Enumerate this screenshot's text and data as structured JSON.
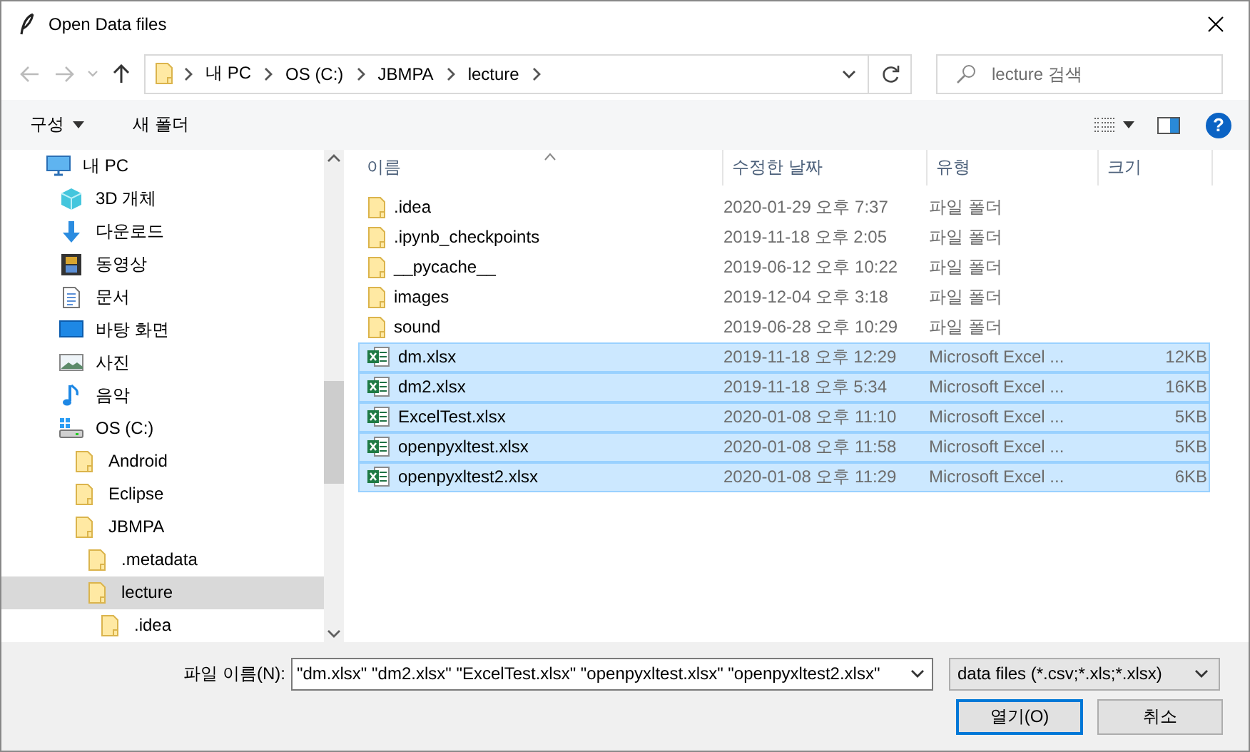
{
  "window": {
    "title": "Open Data files"
  },
  "address": {
    "crumbs": [
      "내 PC",
      "OS (C:)",
      "JBMPA",
      "lecture"
    ]
  },
  "search": {
    "placeholder": "lecture 검색"
  },
  "toolbar": {
    "organize": "구성",
    "new_folder": "새 폴더",
    "help": "?"
  },
  "tree": [
    {
      "label": "내 PC",
      "kind": "pc",
      "selected": false,
      "children": [
        {
          "label": "3D 개체",
          "kind": "cube",
          "selected": false
        },
        {
          "label": "다운로드",
          "kind": "download",
          "selected": false
        },
        {
          "label": "동영상",
          "kind": "video",
          "selected": false
        },
        {
          "label": "문서",
          "kind": "document",
          "selected": false
        },
        {
          "label": "바탕 화면",
          "kind": "desktop",
          "selected": false
        },
        {
          "label": "사진",
          "kind": "picture",
          "selected": false
        },
        {
          "label": "음악",
          "kind": "music",
          "selected": false
        },
        {
          "label": "OS (C:)",
          "kind": "drive",
          "selected": false,
          "children": [
            {
              "label": "Android",
              "kind": "folder",
              "selected": false
            },
            {
              "label": "Eclipse",
              "kind": "folder",
              "selected": false
            },
            {
              "label": "JBMPA",
              "kind": "folder",
              "selected": false,
              "children": [
                {
                  "label": ".metadata",
                  "kind": "folder",
                  "selected": false
                },
                {
                  "label": "lecture",
                  "kind": "folder",
                  "selected": true,
                  "children": [
                    {
                      "label": ".idea",
                      "kind": "folder",
                      "selected": false
                    }
                  ]
                }
              ]
            }
          ]
        }
      ]
    }
  ],
  "list": {
    "columns": [
      "이름",
      "수정한 날짜",
      "유형",
      "크기"
    ],
    "rows": [
      {
        "name": ".idea",
        "date": "2020-01-29 오후 7:37",
        "type": "파일 폴더",
        "kind": "folder",
        "selected": false
      },
      {
        "name": ".ipynb_checkpoints",
        "date": "2019-11-18 오후 2:05",
        "type": "파일 폴더",
        "kind": "folder",
        "selected": false
      },
      {
        "name": "__pycache__",
        "date": "2019-06-12 오후 10:22",
        "type": "파일 폴더",
        "kind": "folder",
        "selected": false
      },
      {
        "name": "images",
        "date": "2019-12-04 오후 3:18",
        "type": "파일 폴더",
        "kind": "folder",
        "selected": false
      },
      {
        "name": "sound",
        "date": "2019-06-28 오후 10:29",
        "type": "파일 폴더",
        "kind": "folder",
        "selected": false
      },
      {
        "name": "dm.xlsx",
        "date": "2019-11-18 오후 12:29",
        "type": "Microsoft Excel ...",
        "size": "12KB",
        "kind": "excel",
        "selected": true
      },
      {
        "name": "dm2.xlsx",
        "date": "2019-11-18 오후 5:34",
        "type": "Microsoft Excel ...",
        "size": "16KB",
        "kind": "excel",
        "selected": true
      },
      {
        "name": "ExcelTest.xlsx",
        "date": "2020-01-08 오후 11:10",
        "type": "Microsoft Excel ...",
        "size": "5KB",
        "kind": "excel",
        "selected": true
      },
      {
        "name": "openpyxltest.xlsx",
        "date": "2020-01-08 오후 11:58",
        "type": "Microsoft Excel ...",
        "size": "5KB",
        "kind": "excel",
        "selected": true
      },
      {
        "name": "openpyxltest2.xlsx",
        "date": "2020-01-08 오후 11:29",
        "type": "Microsoft Excel ...",
        "size": "6KB",
        "kind": "excel",
        "selected": true
      }
    ]
  },
  "footer": {
    "filename_label": "파일 이름(N):",
    "filename": "\"dm.xlsx\" \"dm2.xlsx\" \"ExcelTest.xlsx\" \"openpyxltest.xlsx\" \"openpyxltest2.xlsx\"",
    "filter": "data files (*.csv;*.xls;*.xlsx)",
    "buttons": [
      "열기(O)",
      "취소"
    ]
  }
}
